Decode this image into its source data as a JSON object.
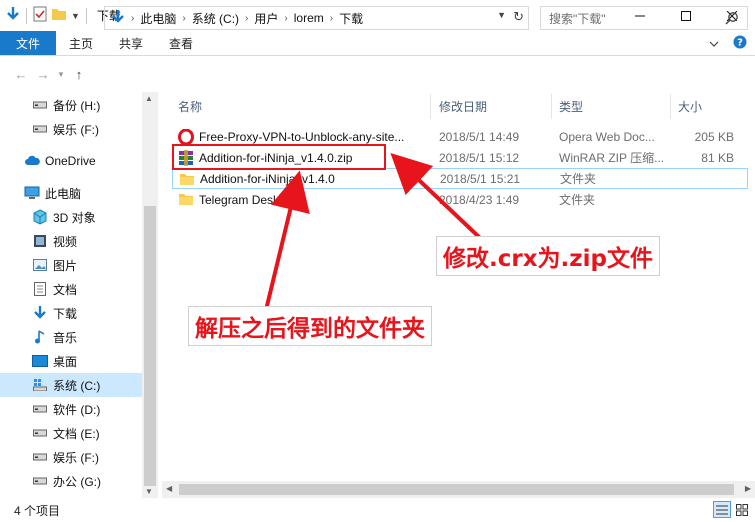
{
  "window": {
    "title": "下载",
    "controls": [
      "minimize-icon",
      "maximize-icon",
      "close-icon"
    ]
  },
  "ribbon": {
    "tabs": [
      "文件",
      "主页",
      "共享",
      "查看"
    ]
  },
  "address": {
    "crumbs": [
      "此电脑",
      "系统 (C:)",
      "用户",
      "lorem",
      "下载"
    ],
    "search_placeholder": "搜索\"下载\""
  },
  "nav": {
    "items": [
      {
        "label": "备份 (H:)",
        "icon": "drive-icon",
        "indent": 1
      },
      {
        "label": "娱乐 (F:)",
        "icon": "drive-icon",
        "indent": 1
      },
      {
        "label": "OneDrive",
        "icon": "cloud-icon",
        "indent": 0
      },
      {
        "label": "此电脑",
        "icon": "computer-icon",
        "indent": 0
      },
      {
        "label": "3D 对象",
        "icon": "cube-icon",
        "indent": 1
      },
      {
        "label": "视频",
        "icon": "video-icon",
        "indent": 1
      },
      {
        "label": "图片",
        "icon": "picture-icon",
        "indent": 1
      },
      {
        "label": "文档",
        "icon": "document-icon",
        "indent": 1
      },
      {
        "label": "下载",
        "icon": "download-icon",
        "indent": 1
      },
      {
        "label": "音乐",
        "icon": "music-icon",
        "indent": 1
      },
      {
        "label": "桌面",
        "icon": "desktop-icon",
        "indent": 1
      },
      {
        "label": "系统 (C:)",
        "icon": "system-drive-icon",
        "indent": 1,
        "selected": true
      },
      {
        "label": "软件 (D:)",
        "icon": "drive-icon",
        "indent": 1
      },
      {
        "label": "文档 (E:)",
        "icon": "drive-icon",
        "indent": 1
      },
      {
        "label": "娱乐 (F:)",
        "icon": "drive-icon",
        "indent": 1
      },
      {
        "label": "办公 (G:)",
        "icon": "drive-icon",
        "indent": 1
      }
    ]
  },
  "columns": {
    "name": "名称",
    "date": "修改日期",
    "type": "类型",
    "size": "大小"
  },
  "files": [
    {
      "name": "Free-Proxy-VPN-to-Unblock-any-site...",
      "date": "2018/5/1 14:49",
      "type": "Opera Web Doc...",
      "size": "205 KB",
      "icon": "opera-icon"
    },
    {
      "name": "Addition-for-iNinja_v1.4.0.zip",
      "date": "2018/5/1 15:12",
      "type": "WinRAR ZIP 压缩...",
      "size": "81 KB",
      "icon": "winrar-icon"
    },
    {
      "name": "Addition-for-iNinja_v1.4.0",
      "date": "2018/5/1 15:21",
      "type": "文件夹",
      "size": "",
      "icon": "folder-icon"
    },
    {
      "name": "Telegram Desktop",
      "date": "2018/4/23 1:49",
      "type": "文件夹",
      "size": "",
      "icon": "folder-icon"
    }
  ],
  "status": {
    "count": "4 个项目"
  },
  "annotations": {
    "rename_note": "修改.crx为.zip文件",
    "extract_note": "解压之后得到的文件夹"
  },
  "colors": {
    "accent": "#1979ca",
    "selection": "#cce8ff",
    "annotation": "#e8141b",
    "folder": "#f5c94c"
  }
}
